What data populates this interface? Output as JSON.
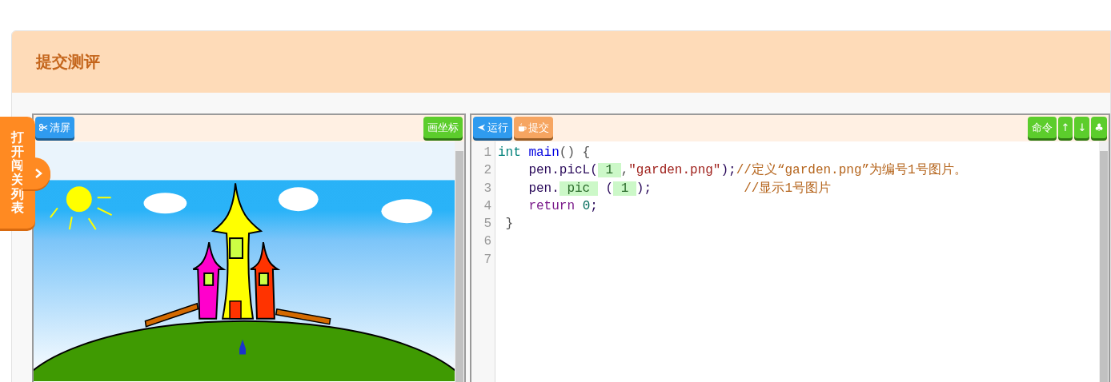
{
  "page_title": "提交测评",
  "level_list_tab": {
    "label": "打开闯关列表"
  },
  "canvas_panel": {
    "buttons": [
      {
        "label": "清屏",
        "kind": "clear"
      },
      {
        "label": "画坐标",
        "kind": "grid"
      }
    ]
  },
  "code_panel": {
    "left_buttons": [
      {
        "label": "运行",
        "kind": "run"
      },
      {
        "label": "提交",
        "kind": "submit"
      }
    ],
    "right_buttons": [
      {
        "label": "命令",
        "kind": "command"
      },
      {
        "label": "↑",
        "kind": "command"
      },
      {
        "label": "↓",
        "kind": "command"
      },
      {
        "label": "♣",
        "kind": "command"
      }
    ],
    "lines": [
      {
        "number": "1",
        "tokens": [
          {
            "text": "int ",
            "kind": "type"
          },
          {
            "text": "main",
            "kind": "func"
          },
          {
            "text": "() {",
            "kind": "punct"
          }
        ]
      },
      {
        "number": "2",
        "tokens": [
          {
            "text": "    pen.picL(",
            "kind": "plain"
          },
          {
            "text": " 1 ",
            "kind": "highlight"
          },
          {
            "text": ",",
            "kind": "punct"
          },
          {
            "text": "\"garden.png\"",
            "kind": "string"
          },
          {
            "text": ");",
            "kind": "plain"
          },
          {
            "text": "//定义“garden.png”为编号1号图片。",
            "kind": "comment"
          }
        ]
      },
      {
        "number": "3",
        "tokens": [
          {
            "text": "    pen.",
            "kind": "plain"
          },
          {
            "text": " pic ",
            "kind": "highlight"
          },
          {
            "text": " (",
            "kind": "plain"
          },
          {
            "text": " 1 ",
            "kind": "highlight"
          },
          {
            "text": ");            ",
            "kind": "plain"
          },
          {
            "text": "//显示1号图片",
            "kind": "comment"
          }
        ]
      },
      {
        "number": "4",
        "tokens": [
          {
            "text": "    return ",
            "kind": "keyword"
          },
          {
            "text": "0",
            "kind": "number"
          },
          {
            "text": ";",
            "kind": "plain"
          }
        ]
      },
      {
        "number": "5",
        "tokens": [
          {
            "text": " }",
            "kind": "punct"
          }
        ]
      },
      {
        "number": "6"
      },
      {
        "number": "7"
      }
    ]
  }
}
